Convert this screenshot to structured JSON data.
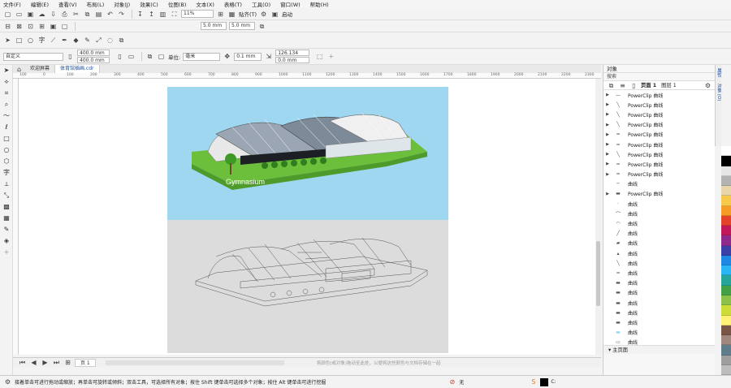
{
  "menu": [
    "文件(F)",
    "编辑(E)",
    "查看(V)",
    "布局(L)",
    "对象(J)",
    "效果(C)",
    "位图(B)",
    "文本(X)",
    "表格(T)",
    "工具(O)",
    "窗口(W)",
    "帮助(H)"
  ],
  "toolbar": {
    "zoom": "11%",
    "snap_label": "贴齐(T)",
    "launch_label": "启动"
  },
  "toolbar2": {
    "dim1": "5.0 mm",
    "dim2": "5.0 mm"
  },
  "props": {
    "preset": "自定义",
    "width": "400.0 mm",
    "height": "400.0 mm",
    "units_label": "单位:",
    "units": "毫米",
    "nudge": "0.1 mm",
    "dupx": "126.134 mm",
    "dupy": "0.0 mm"
  },
  "tabs": [
    {
      "label": "欢迎屏幕"
    },
    {
      "label": "体育馆插画.cdr"
    }
  ],
  "ruler_ticks": [
    "100",
    "0",
    "100",
    "200",
    "300",
    "400",
    "500",
    "600",
    "700",
    "800",
    "900",
    "1000",
    "1100",
    "1200",
    "1300",
    "1400",
    "1500",
    "1600",
    "1700",
    "1800",
    "1900",
    "2000",
    "2100",
    "2200",
    "2300"
  ],
  "illustration": {
    "label": "Gymnasium"
  },
  "page_nav": {
    "page": "页 1"
  },
  "canvas_hint": "将颜色(或对象)拖动至此处，以便将这些颜色与文档存储在一起",
  "status": {
    "text": "接着单击可进行拖动或缩放；再单击可旋转或倾斜；双击工具，可选择所有对象；按住 Shift 键单击可选择多个对象；按住 Alt 键单击可进行挖掘",
    "fill": "无",
    "c_label": "C:"
  },
  "panel": {
    "title": "对象",
    "search": "搜索",
    "page": "页面 1",
    "layer": "图层 1",
    "footer": "主页面",
    "rows": [
      {
        "label": "PowerClip 曲线",
        "arrow": true
      },
      {
        "label": "PowerClip 曲线",
        "arrow": true
      },
      {
        "label": "PowerClip 曲线",
        "arrow": true
      },
      {
        "label": "PowerClip 曲线",
        "arrow": true
      },
      {
        "label": "PowerClip 曲线",
        "arrow": true
      },
      {
        "label": "PowerClip 曲线",
        "arrow": true
      },
      {
        "label": "PowerClip 曲线",
        "arrow": true
      },
      {
        "label": "PowerClip 曲线",
        "arrow": true
      },
      {
        "label": "PowerClip 曲线",
        "arrow": true
      },
      {
        "label": "曲线",
        "arrow": false
      },
      {
        "label": "PowerClip 曲线",
        "arrow": true
      },
      {
        "label": "曲线",
        "arrow": false
      },
      {
        "label": "曲线",
        "arrow": false
      },
      {
        "label": "曲线",
        "arrow": false
      },
      {
        "label": "曲线",
        "arrow": false
      },
      {
        "label": "曲线",
        "arrow": false
      },
      {
        "label": "曲线",
        "arrow": false
      },
      {
        "label": "曲线",
        "arrow": false
      },
      {
        "label": "曲线",
        "arrow": false
      },
      {
        "label": "曲线",
        "arrow": false
      },
      {
        "label": "曲线",
        "arrow": false
      },
      {
        "label": "曲线",
        "arrow": false
      },
      {
        "label": "曲线",
        "arrow": false
      },
      {
        "label": "曲线",
        "arrow": false
      },
      {
        "label": "曲线",
        "arrow": false
      },
      {
        "label": "曲线",
        "arrow": false
      }
    ]
  },
  "sidetabs": [
    "属性",
    "对象 (O)"
  ],
  "palette": [
    "#ffffff",
    "#000000",
    "#e6e6e6",
    "#b3b3b3",
    "#e8d5a8",
    "#f7c84a",
    "#f59a22",
    "#e5422b",
    "#c2185b",
    "#8e2a8c",
    "#3b3fa8",
    "#1e88e5",
    "#29b6f6",
    "#26a69a",
    "#43a047",
    "#8bc34a",
    "#cddc39",
    "#fff176",
    "#795548",
    "#a1887f",
    "#607d8b",
    "#9e9e9e",
    "#bdbdbd"
  ]
}
